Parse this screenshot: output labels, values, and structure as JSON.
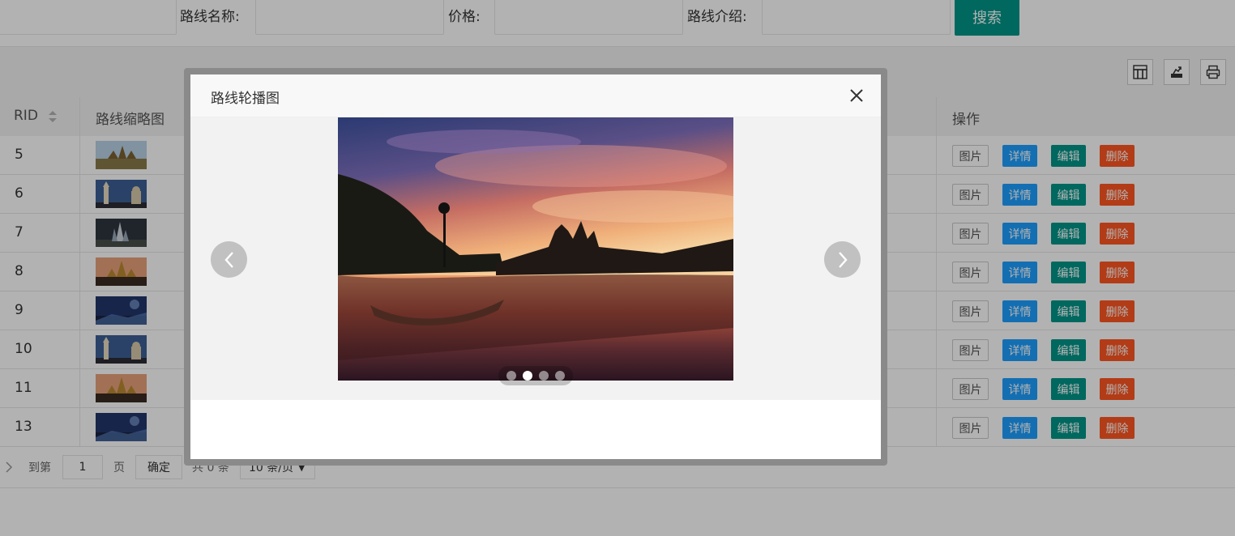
{
  "search": {
    "route_name_label": "路线名称:",
    "price_label": "价格:",
    "intro_label": "路线介绍:",
    "route_name_value": "",
    "price_value": "",
    "intro_value": "",
    "search_button": "搜索"
  },
  "toolbar": {
    "icons": [
      "columns-icon",
      "export-icon",
      "print-icon"
    ]
  },
  "table": {
    "headers": {
      "rid": "RID",
      "thumbnail": "路线缩略图",
      "actions": "操作"
    },
    "rows": [
      {
        "rid": "5",
        "thumb": "temple-daylight"
      },
      {
        "rid": "6",
        "thumb": "clocktower-evening"
      },
      {
        "rid": "7",
        "thumb": "night-tower"
      },
      {
        "rid": "8",
        "thumb": "temple-sunset"
      },
      {
        "rid": "9",
        "thumb": "bay-night"
      },
      {
        "rid": "10",
        "thumb": "clocktower-evening"
      },
      {
        "rid": "11",
        "thumb": "temple-sunset"
      },
      {
        "rid": "13",
        "thumb": "bay-night"
      }
    ],
    "action_labels": {
      "pic": "图片",
      "detail": "详情",
      "edit": "编辑",
      "delete": "删除"
    }
  },
  "pager": {
    "goto_label": "到第",
    "page_value": "1",
    "page_suffix": "页",
    "confirm": "确定",
    "total": "共 0 条",
    "page_size": "10 条/页"
  },
  "modal": {
    "title": "路线轮播图",
    "active_slide": 2,
    "slide_count": 4
  },
  "colors": {
    "primary": "#009688",
    "detail": "#1E9FFF",
    "danger": "#FF5722"
  }
}
